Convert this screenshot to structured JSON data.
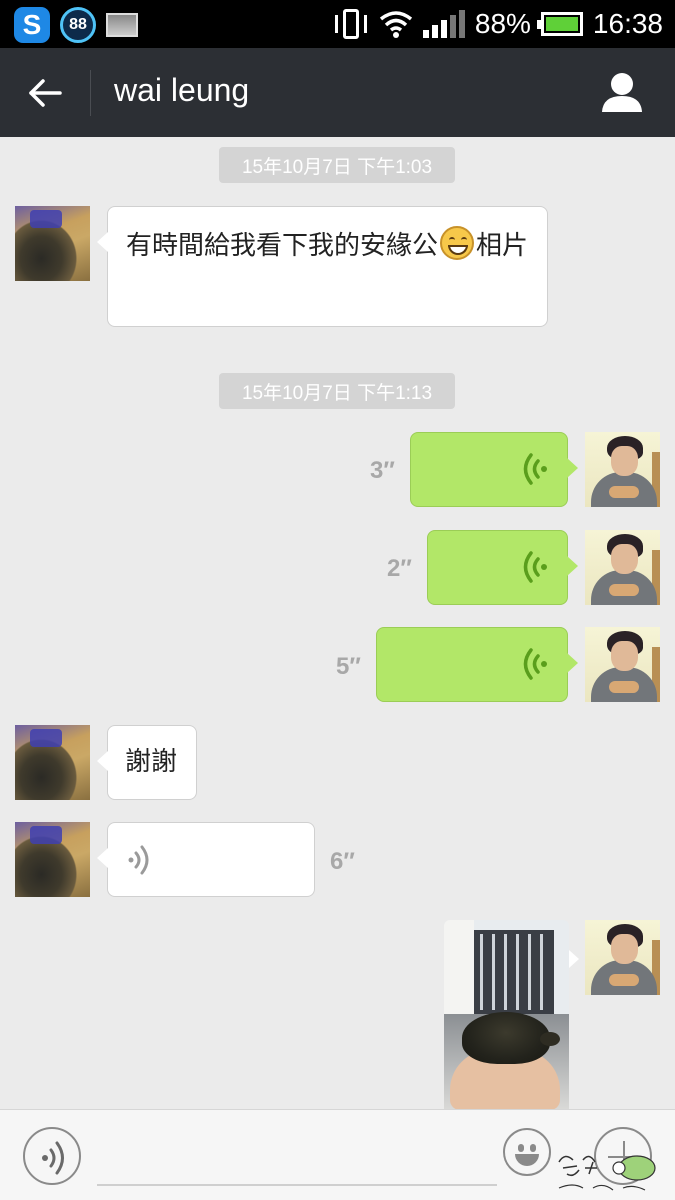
{
  "status_bar": {
    "left_icons": [
      "s-app-icon",
      "badge-88-icon",
      "image-notification-icon"
    ],
    "badge_text": "88",
    "s_text": "S",
    "battery_percent": "88%",
    "battery_level": 0.88,
    "time": "16:38",
    "right_icons": [
      "vibrate-icon",
      "wifi-icon",
      "signal-icon",
      "battery-icon"
    ]
  },
  "header": {
    "back_icon": "arrow-left-icon",
    "title": "wai leung",
    "profile_icon": "person-icon",
    "background": "#2c2f34"
  },
  "chat": {
    "timestamps": [
      "15年10月7日 下午1:03",
      "15年10月7日 下午1:13"
    ],
    "messages": [
      {
        "sender": "wai leung",
        "type": "text",
        "text_before": "有時間給我看下我的安緣公",
        "emoji": "grinning-face-emoji",
        "text_after": "相片"
      },
      {
        "sender": "me",
        "type": "voice",
        "duration": "3″"
      },
      {
        "sender": "me",
        "type": "voice",
        "duration": "2″"
      },
      {
        "sender": "me",
        "type": "voice",
        "duration": "5″"
      },
      {
        "sender": "wai leung",
        "type": "text",
        "text": "謝謝"
      },
      {
        "sender": "wai leung",
        "type": "voice",
        "duration": "6″"
      },
      {
        "sender": "me",
        "type": "image",
        "description_icon": "turtle-photo"
      }
    ],
    "colors": {
      "sent_bubble": "#b2e768",
      "received_bubble": "#ffffff",
      "voice_wave_green": "#5a9e1c",
      "background": "#ebebeb"
    }
  },
  "input_bar": {
    "voice_toggle_icon": "voice-wave-icon",
    "text_placeholder": "",
    "emoji_icon": "smiley-icon",
    "plus_icon": "plus-icon"
  }
}
